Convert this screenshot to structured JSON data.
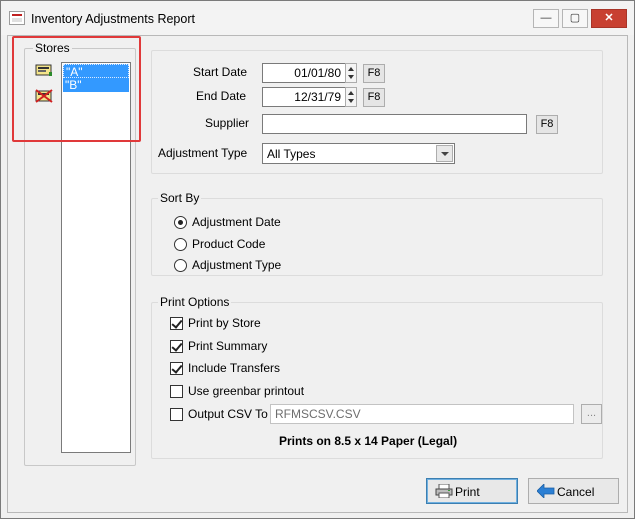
{
  "window": {
    "title": "Inventory Adjustments Report",
    "close_glyph": "✕",
    "max_glyph": "▢",
    "min_glyph": "—"
  },
  "stores": {
    "legend": "Stores",
    "items": [
      {
        "label": "\"A\"",
        "icon": "store-icon"
      },
      {
        "label": "\"B\"",
        "icon": "store-closed-icon"
      }
    ]
  },
  "params": {
    "start_date_label": "Start Date",
    "start_date_value": "01/01/80",
    "end_date_label": "End Date",
    "end_date_value": "12/31/79",
    "supplier_label": "Supplier",
    "supplier_value": "",
    "adjustment_type_label": "Adjustment Type",
    "adjustment_type_value": "All Types",
    "lookup_button_label": "F8"
  },
  "sort_by": {
    "legend": "Sort By",
    "options": [
      {
        "label": "Adjustment Date",
        "selected": true
      },
      {
        "label": "Product Code",
        "selected": false
      },
      {
        "label": "Adjustment Type",
        "selected": false
      }
    ]
  },
  "print_options": {
    "legend": "Print Options",
    "checks": [
      {
        "label": "Print by Store",
        "checked": true
      },
      {
        "label": "Print Summary",
        "checked": true
      },
      {
        "label": "Include Transfers",
        "checked": true
      },
      {
        "label": "Use greenbar printout",
        "checked": false
      },
      {
        "label": "Output CSV To",
        "checked": false
      }
    ],
    "csv_path": "RFMSCSV.CSV",
    "browse_label": "...",
    "paper_note": "Prints on 8.5 x 14 Paper (Legal)"
  },
  "buttons": {
    "print_label": "Print",
    "cancel_label": "Cancel"
  },
  "colors": {
    "selection": "#3399ff",
    "highlight_border": "#e0393a",
    "close_button": "#c84031"
  }
}
